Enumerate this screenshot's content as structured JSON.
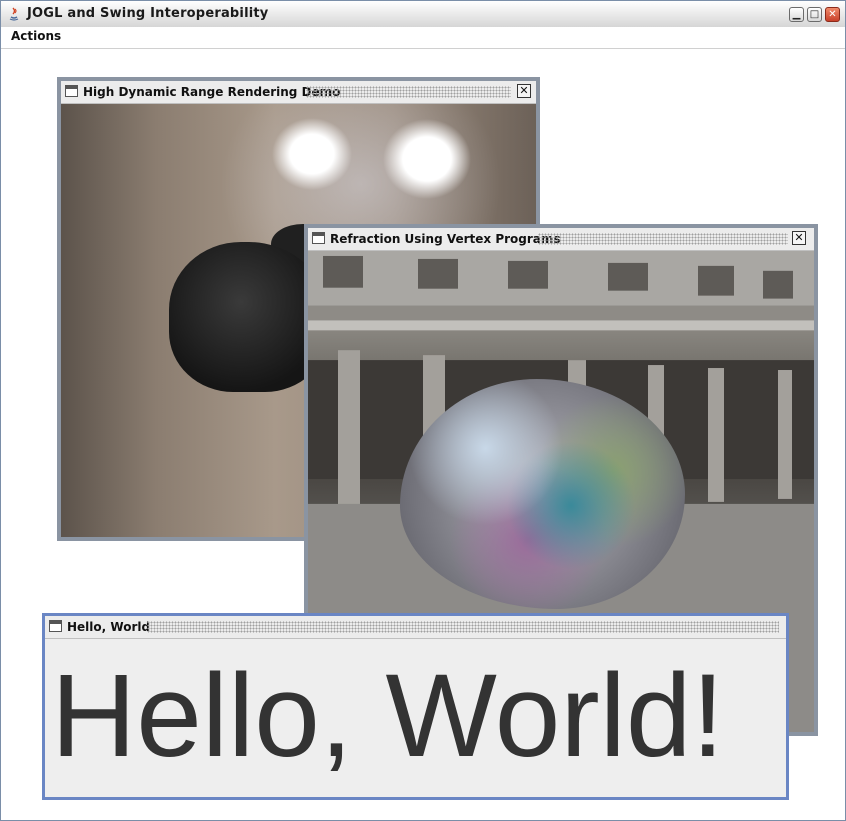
{
  "window": {
    "title": "JOGL and Swing Interoperability",
    "icon": "java-icon",
    "buttons": {
      "minimize": "minimize-icon",
      "maximize": "maximize-icon",
      "close": "close-icon"
    }
  },
  "menubar": {
    "items": [
      {
        "label": "Actions"
      }
    ]
  },
  "frames": {
    "hdr": {
      "title": "High Dynamic Range Rendering Demo",
      "close_icon": "close-icon"
    },
    "refraction": {
      "title": "Refraction Using Vertex Programs",
      "close_icon": "close-icon"
    },
    "hello": {
      "title": "Hello, World",
      "content": "Hello, World!"
    }
  },
  "colors": {
    "active_frame_border": "#6a86c4",
    "inactive_frame_border": "#8a94a2",
    "hello_text": "#333333"
  }
}
